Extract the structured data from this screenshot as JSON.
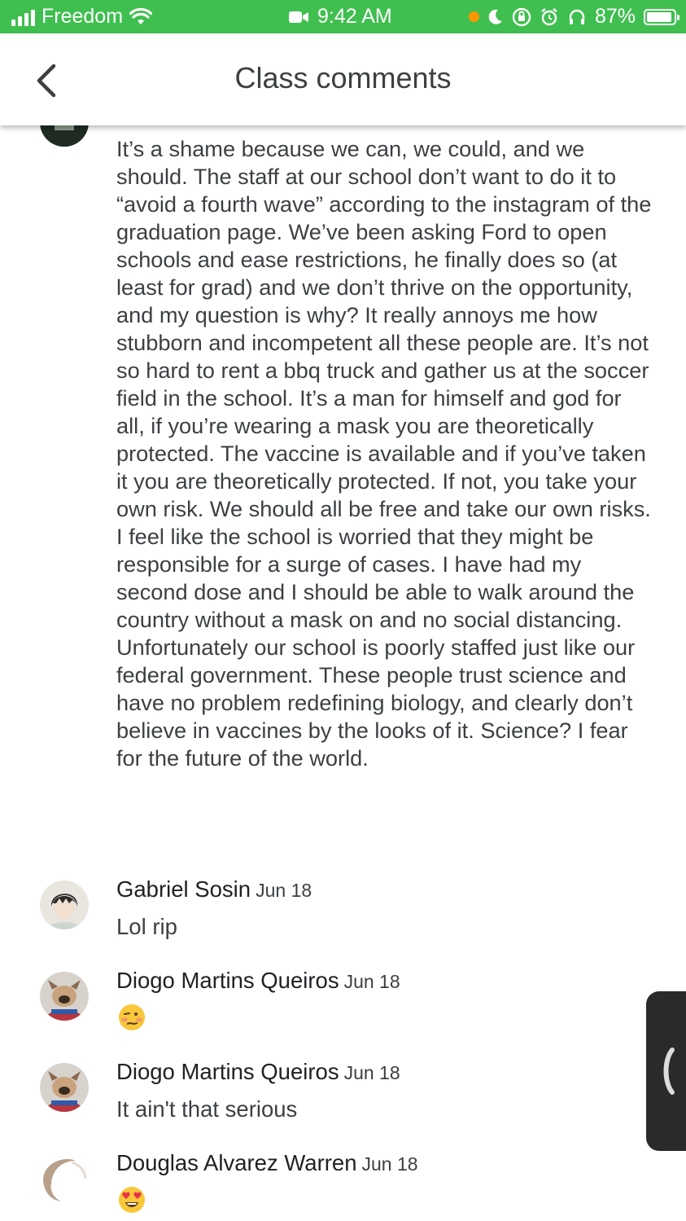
{
  "status_bar": {
    "carrier": "Freedom",
    "time": "9:42 AM",
    "battery": "87%",
    "colors": {
      "background": "#3fbf4f"
    }
  },
  "header": {
    "title": "Class comments",
    "back_icon": "chevron-left-icon"
  },
  "long_comment": {
    "text": "It’s a shame because we can, we could, and we should. The staff at our school don’t want to do it to “avoid a fourth wave” according to the instagram of the graduation page. We’ve been asking Ford to open schools and ease restrictions, he finally does so (at least for grad) and we don’t thrive on the opportunity, and my question is why? It really annoys me how stubborn and incompetent all these people are. It’s not so hard to rent a bbq truck and gather us at the soccer field in the school. It’s a man for himself and god for all, if you’re wearing a mask you are theoretically protected. The vaccine is available and if you’ve taken it you are theoretically protected. If not, you take your own risk. We should all be free and take our own risks. I feel like the school is worried that they might be responsible for a surge of cases. I have had my second dose and I should be able to walk around the country without a mask on and no social distancing. Unfortunately our school is poorly staffed just like our federal government. These people trust science and have no problem redefining biology, and clearly don’t believe in vaccines by the looks of it. Science? I fear for the future of the world."
  },
  "comments": [
    {
      "author": "Gabriel Sosin",
      "date": "Jun 18",
      "text": "Lol rip"
    },
    {
      "author": "Diogo Martins Queiros",
      "date": "Jun 18",
      "emoji": "woozy-face-emoji"
    },
    {
      "author": "Diogo Martins Queiros",
      "date": "Jun 18",
      "text": "It ain't that serious"
    },
    {
      "author": "Douglas Alvarez Warren",
      "date": "Jun 18",
      "emoji": "heart-eyes-emoji"
    }
  ]
}
